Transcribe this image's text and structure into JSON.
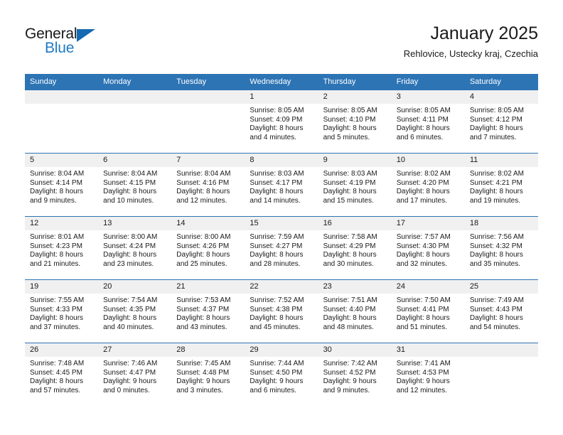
{
  "logo": {
    "word_one": "General",
    "word_two": "Blue",
    "triangle_color": "#1669b2",
    "blue_color": "#1f7ac4"
  },
  "header": {
    "month_title": "January 2025",
    "location": "Rehlovice, Ustecky kraj, Czechia"
  },
  "theme": {
    "header_blue": "#2d74b5",
    "daynum_band": "#f0f0f0",
    "text": "#1a1a1a"
  },
  "weekday_headers": [
    "Sunday",
    "Monday",
    "Tuesday",
    "Wednesday",
    "Thursday",
    "Friday",
    "Saturday"
  ],
  "weeks": [
    [
      {
        "day": "",
        "empty": true,
        "sunrise": "",
        "sunset": "",
        "daylight_line1": "",
        "daylight_line2": ""
      },
      {
        "day": "",
        "empty": true,
        "sunrise": "",
        "sunset": "",
        "daylight_line1": "",
        "daylight_line2": ""
      },
      {
        "day": "",
        "empty": true,
        "sunrise": "",
        "sunset": "",
        "daylight_line1": "",
        "daylight_line2": ""
      },
      {
        "day": "1",
        "empty": false,
        "sunrise": "Sunrise: 8:05 AM",
        "sunset": "Sunset: 4:09 PM",
        "daylight_line1": "Daylight: 8 hours",
        "daylight_line2": "and 4 minutes."
      },
      {
        "day": "2",
        "empty": false,
        "sunrise": "Sunrise: 8:05 AM",
        "sunset": "Sunset: 4:10 PM",
        "daylight_line1": "Daylight: 8 hours",
        "daylight_line2": "and 5 minutes."
      },
      {
        "day": "3",
        "empty": false,
        "sunrise": "Sunrise: 8:05 AM",
        "sunset": "Sunset: 4:11 PM",
        "daylight_line1": "Daylight: 8 hours",
        "daylight_line2": "and 6 minutes."
      },
      {
        "day": "4",
        "empty": false,
        "sunrise": "Sunrise: 8:05 AM",
        "sunset": "Sunset: 4:12 PM",
        "daylight_line1": "Daylight: 8 hours",
        "daylight_line2": "and 7 minutes."
      }
    ],
    [
      {
        "day": "5",
        "empty": false,
        "sunrise": "Sunrise: 8:04 AM",
        "sunset": "Sunset: 4:14 PM",
        "daylight_line1": "Daylight: 8 hours",
        "daylight_line2": "and 9 minutes."
      },
      {
        "day": "6",
        "empty": false,
        "sunrise": "Sunrise: 8:04 AM",
        "sunset": "Sunset: 4:15 PM",
        "daylight_line1": "Daylight: 8 hours",
        "daylight_line2": "and 10 minutes."
      },
      {
        "day": "7",
        "empty": false,
        "sunrise": "Sunrise: 8:04 AM",
        "sunset": "Sunset: 4:16 PM",
        "daylight_line1": "Daylight: 8 hours",
        "daylight_line2": "and 12 minutes."
      },
      {
        "day": "8",
        "empty": false,
        "sunrise": "Sunrise: 8:03 AM",
        "sunset": "Sunset: 4:17 PM",
        "daylight_line1": "Daylight: 8 hours",
        "daylight_line2": "and 14 minutes."
      },
      {
        "day": "9",
        "empty": false,
        "sunrise": "Sunrise: 8:03 AM",
        "sunset": "Sunset: 4:19 PM",
        "daylight_line1": "Daylight: 8 hours",
        "daylight_line2": "and 15 minutes."
      },
      {
        "day": "10",
        "empty": false,
        "sunrise": "Sunrise: 8:02 AM",
        "sunset": "Sunset: 4:20 PM",
        "daylight_line1": "Daylight: 8 hours",
        "daylight_line2": "and 17 minutes."
      },
      {
        "day": "11",
        "empty": false,
        "sunrise": "Sunrise: 8:02 AM",
        "sunset": "Sunset: 4:21 PM",
        "daylight_line1": "Daylight: 8 hours",
        "daylight_line2": "and 19 minutes."
      }
    ],
    [
      {
        "day": "12",
        "empty": false,
        "sunrise": "Sunrise: 8:01 AM",
        "sunset": "Sunset: 4:23 PM",
        "daylight_line1": "Daylight: 8 hours",
        "daylight_line2": "and 21 minutes."
      },
      {
        "day": "13",
        "empty": false,
        "sunrise": "Sunrise: 8:00 AM",
        "sunset": "Sunset: 4:24 PM",
        "daylight_line1": "Daylight: 8 hours",
        "daylight_line2": "and 23 minutes."
      },
      {
        "day": "14",
        "empty": false,
        "sunrise": "Sunrise: 8:00 AM",
        "sunset": "Sunset: 4:26 PM",
        "daylight_line1": "Daylight: 8 hours",
        "daylight_line2": "and 25 minutes."
      },
      {
        "day": "15",
        "empty": false,
        "sunrise": "Sunrise: 7:59 AM",
        "sunset": "Sunset: 4:27 PM",
        "daylight_line1": "Daylight: 8 hours",
        "daylight_line2": "and 28 minutes."
      },
      {
        "day": "16",
        "empty": false,
        "sunrise": "Sunrise: 7:58 AM",
        "sunset": "Sunset: 4:29 PM",
        "daylight_line1": "Daylight: 8 hours",
        "daylight_line2": "and 30 minutes."
      },
      {
        "day": "17",
        "empty": false,
        "sunrise": "Sunrise: 7:57 AM",
        "sunset": "Sunset: 4:30 PM",
        "daylight_line1": "Daylight: 8 hours",
        "daylight_line2": "and 32 minutes."
      },
      {
        "day": "18",
        "empty": false,
        "sunrise": "Sunrise: 7:56 AM",
        "sunset": "Sunset: 4:32 PM",
        "daylight_line1": "Daylight: 8 hours",
        "daylight_line2": "and 35 minutes."
      }
    ],
    [
      {
        "day": "19",
        "empty": false,
        "sunrise": "Sunrise: 7:55 AM",
        "sunset": "Sunset: 4:33 PM",
        "daylight_line1": "Daylight: 8 hours",
        "daylight_line2": "and 37 minutes."
      },
      {
        "day": "20",
        "empty": false,
        "sunrise": "Sunrise: 7:54 AM",
        "sunset": "Sunset: 4:35 PM",
        "daylight_line1": "Daylight: 8 hours",
        "daylight_line2": "and 40 minutes."
      },
      {
        "day": "21",
        "empty": false,
        "sunrise": "Sunrise: 7:53 AM",
        "sunset": "Sunset: 4:37 PM",
        "daylight_line1": "Daylight: 8 hours",
        "daylight_line2": "and 43 minutes."
      },
      {
        "day": "22",
        "empty": false,
        "sunrise": "Sunrise: 7:52 AM",
        "sunset": "Sunset: 4:38 PM",
        "daylight_line1": "Daylight: 8 hours",
        "daylight_line2": "and 45 minutes."
      },
      {
        "day": "23",
        "empty": false,
        "sunrise": "Sunrise: 7:51 AM",
        "sunset": "Sunset: 4:40 PM",
        "daylight_line1": "Daylight: 8 hours",
        "daylight_line2": "and 48 minutes."
      },
      {
        "day": "24",
        "empty": false,
        "sunrise": "Sunrise: 7:50 AM",
        "sunset": "Sunset: 4:41 PM",
        "daylight_line1": "Daylight: 8 hours",
        "daylight_line2": "and 51 minutes."
      },
      {
        "day": "25",
        "empty": false,
        "sunrise": "Sunrise: 7:49 AM",
        "sunset": "Sunset: 4:43 PM",
        "daylight_line1": "Daylight: 8 hours",
        "daylight_line2": "and 54 minutes."
      }
    ],
    [
      {
        "day": "26",
        "empty": false,
        "sunrise": "Sunrise: 7:48 AM",
        "sunset": "Sunset: 4:45 PM",
        "daylight_line1": "Daylight: 8 hours",
        "daylight_line2": "and 57 minutes."
      },
      {
        "day": "27",
        "empty": false,
        "sunrise": "Sunrise: 7:46 AM",
        "sunset": "Sunset: 4:47 PM",
        "daylight_line1": "Daylight: 9 hours",
        "daylight_line2": "and 0 minutes."
      },
      {
        "day": "28",
        "empty": false,
        "sunrise": "Sunrise: 7:45 AM",
        "sunset": "Sunset: 4:48 PM",
        "daylight_line1": "Daylight: 9 hours",
        "daylight_line2": "and 3 minutes."
      },
      {
        "day": "29",
        "empty": false,
        "sunrise": "Sunrise: 7:44 AM",
        "sunset": "Sunset: 4:50 PM",
        "daylight_line1": "Daylight: 9 hours",
        "daylight_line2": "and 6 minutes."
      },
      {
        "day": "30",
        "empty": false,
        "sunrise": "Sunrise: 7:42 AM",
        "sunset": "Sunset: 4:52 PM",
        "daylight_line1": "Daylight: 9 hours",
        "daylight_line2": "and 9 minutes."
      },
      {
        "day": "31",
        "empty": false,
        "sunrise": "Sunrise: 7:41 AM",
        "sunset": "Sunset: 4:53 PM",
        "daylight_line1": "Daylight: 9 hours",
        "daylight_line2": "and 12 minutes."
      },
      {
        "day": "",
        "empty": true,
        "sunrise": "",
        "sunset": "",
        "daylight_line1": "",
        "daylight_line2": ""
      }
    ]
  ]
}
